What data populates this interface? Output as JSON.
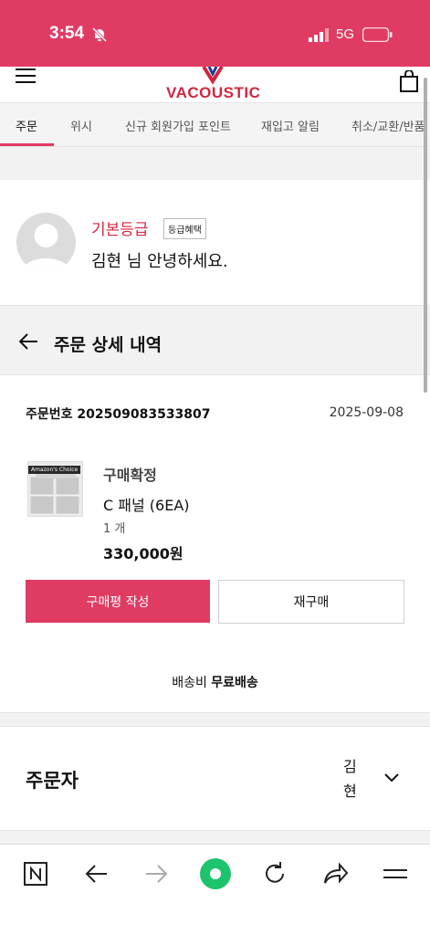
{
  "status_bar": {
    "time": "3:54",
    "network": "5G",
    "bg_color": "#e03c63"
  },
  "header": {
    "logo_text": "VACOUSTIC",
    "brand_color": "#d22640"
  },
  "tabs": [
    {
      "label": "주문",
      "active": true
    },
    {
      "label": "위시"
    },
    {
      "label": "신규 회원가입 포인트"
    },
    {
      "label": "재입고 알림"
    },
    {
      "label": "취소/교환/반품"
    }
  ],
  "profile": {
    "grade": "기본등급",
    "grade_badge": "등급혜택",
    "greeting": "김현 님 안녕하세요."
  },
  "section": {
    "title": "주문 상세 내역"
  },
  "order": {
    "number_label": "주문번호",
    "number": "202509083533807",
    "date": "2025-09-08",
    "thumb_badge": "Amazon's Choice",
    "item_status": "구매확정",
    "item_name": "C 패널 (6EA)",
    "item_qty": "1 개",
    "item_price": "330,000원",
    "review_button": "구매평 작성",
    "reorder_button": "재구매",
    "shipping_label": "배송비",
    "shipping_value": "무료배송"
  },
  "orderer": {
    "title": "주문자",
    "name": "김현"
  },
  "browser_bar": {
    "icons": [
      "naver-icon",
      "back-arrow-icon",
      "forward-arrow-icon",
      "green-dot-icon",
      "reload-icon",
      "share-icon",
      "menu-icon"
    ]
  }
}
